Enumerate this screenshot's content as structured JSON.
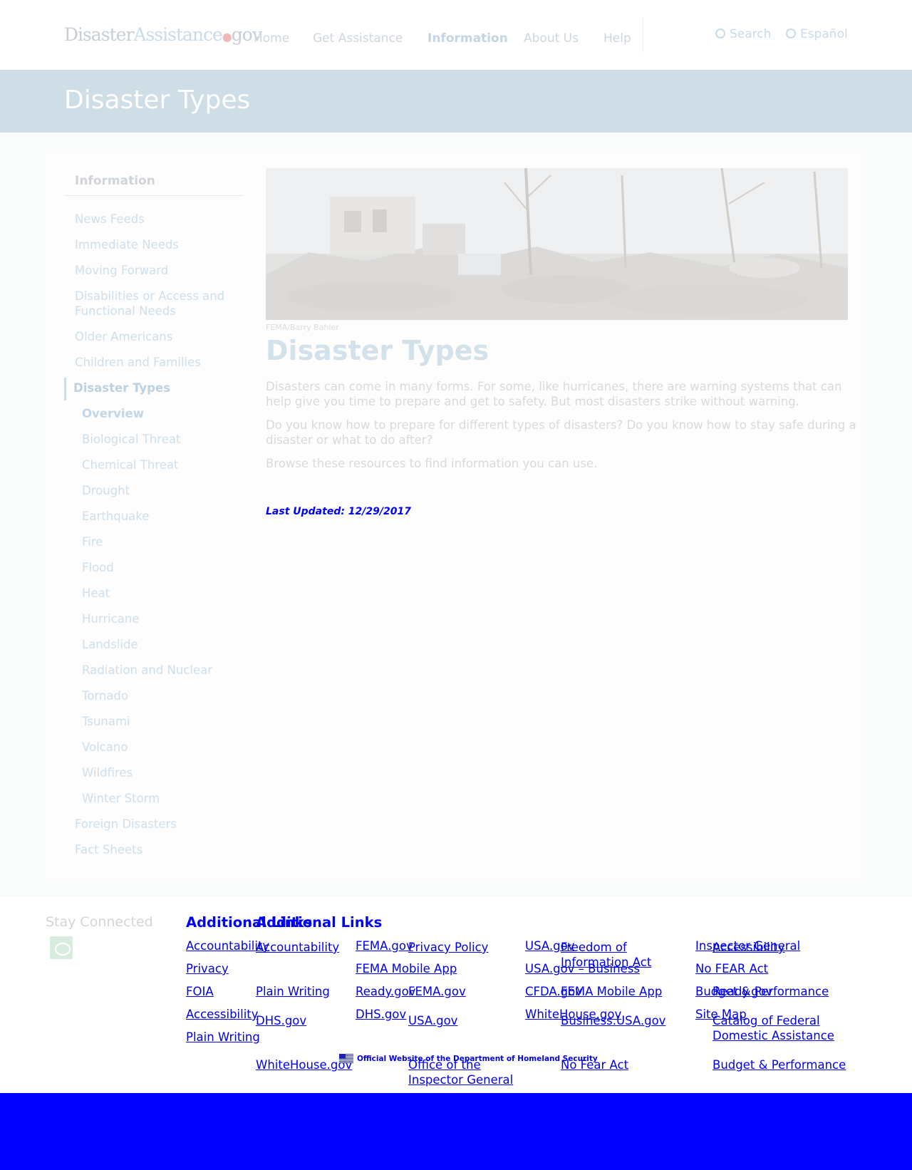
{
  "header": {
    "logo_part1": "Disaster",
    "logo_part2": "Assistance",
    "logo_part3": "gov",
    "nav": {
      "home": "Home",
      "get_assistance": "Get Assistance",
      "information": "Information",
      "about_us": "About Us",
      "help": "Help"
    },
    "search_label": "Search",
    "language_label": "Español"
  },
  "banner": {
    "title": "Disaster Types"
  },
  "sidebar": {
    "heading": "Information",
    "items": [
      "News Feeds",
      "Immediate Needs",
      "Moving Forward",
      "Disabilities or Access and Functional Needs",
      "Older Americans",
      "Children and Families",
      "Disaster Types"
    ],
    "sub_items": [
      "Overview",
      "Biological Threat",
      "Chemical Threat",
      "Drought",
      "Earthquake",
      "Fire",
      "Flood",
      "Heat",
      "Hurricane",
      "Landslide",
      "Radiation and Nuclear",
      "Tornado",
      "Tsunami",
      "Volcano",
      "Wildfires",
      "Winter Storm"
    ],
    "after_items": [
      "Foreign Disasters",
      "Fact Sheets"
    ]
  },
  "main": {
    "photo_credit": "FEMA/Barry Bahler",
    "title": "Disaster Types",
    "paragraphs": [
      "Disasters can come in many forms. For some, like hurricanes, there are warning systems that can help give you time to prepare and get to safety. But most disasters strike without warning.",
      "Do you know how to prepare for different types of disasters? Do you know how to stay safe during a disaster or what to do after?",
      "Browse these resources to find information you can use."
    ],
    "last_updated": "Last Updated: 12/29/2017"
  },
  "footer": {
    "stay_connected": "Stay Connected",
    "additional_links_heading_a": "Additional Links",
    "additional_links_heading_b": "Additional Links",
    "set_a": {
      "col1": [
        "Accountability",
        "Privacy",
        "FOIA",
        "Accessibility",
        "Plain Writing"
      ],
      "col2": [
        "FEMA.gov",
        "FEMA Mobile App",
        "Ready.gov",
        "DHS.gov"
      ],
      "col3": [
        "USA.gov",
        "USA.gov – Business",
        "CFDA.gov",
        "WhiteHouse.gov"
      ],
      "col4": [
        "Inspector General",
        "No FEAR Act",
        "Budget & Performance",
        "Site Map"
      ]
    },
    "set_b": {
      "row1": [
        "Accountability",
        "Privacy Policy",
        "Freedom of Information Act",
        "Accessibility"
      ],
      "row2": [
        "Plain Writing",
        "FEMA.gov",
        "FEMA Mobile App",
        "Ready.gov"
      ],
      "row3": [
        "DHS.gov",
        "USA.gov",
        "Business.USA.gov",
        "Catalog of Federal Domestic Assistance"
      ],
      "row4": [
        "WhiteHouse.gov",
        "Office of the Inspector General",
        "No Fear Act",
        "Budget & Performance"
      ]
    },
    "official_site": "Official Website of the Department of Homeland Security"
  },
  "colors": {
    "banner": "#cedde6",
    "footer_bar": "#0000ff",
    "link": "#0000ee"
  }
}
